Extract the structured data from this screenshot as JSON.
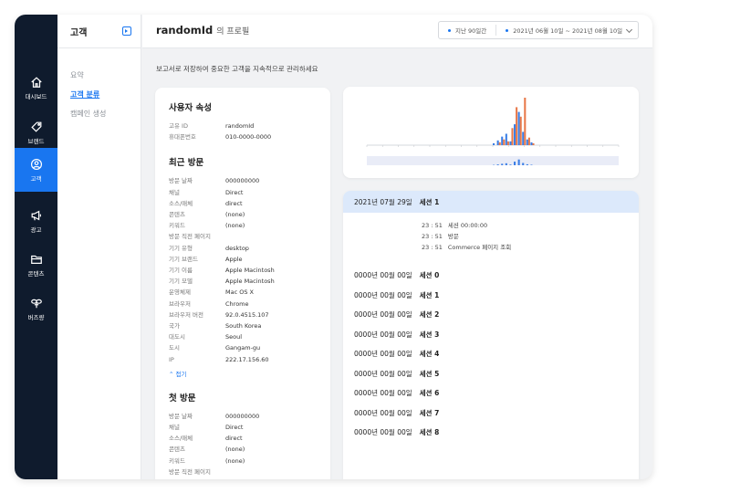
{
  "rail": [
    {
      "label": "대시보드",
      "icon": "home-icon"
    },
    {
      "label": "브랜드",
      "icon": "tag-icon"
    },
    {
      "label": "고객",
      "icon": "user-icon",
      "active": true
    },
    {
      "label": "광고",
      "icon": "megaphone-icon"
    },
    {
      "label": "콘텐츠",
      "icon": "folder-icon"
    },
    {
      "label": "버즈량",
      "icon": "buzz-icon"
    }
  ],
  "subnav": {
    "title": "고객",
    "links": [
      {
        "label": "요약",
        "active": false
      },
      {
        "label": "고객 분류",
        "active": true
      },
      {
        "label": "캠페인 생성",
        "active": false
      }
    ]
  },
  "header": {
    "user": "randomId",
    "suffix": "의 프로필",
    "range_label": "지난 90일간",
    "range_value": "2021년 06월 10일 ~ 2021년 08월 10일"
  },
  "hint": "보고서로 저장하여 중요한 고객을 지속적으로 관리하세요",
  "attributes": {
    "title": "사용자 속성",
    "rows": [
      {
        "k": "고유 ID",
        "v": "randomId"
      },
      {
        "k": "휴대폰번호",
        "v": "010-0000-0000"
      }
    ]
  },
  "recent_visit": {
    "title": "최근 방문",
    "rows": [
      {
        "k": "방문 날짜",
        "v": "000000000"
      },
      {
        "k": "채널",
        "v": "Direct"
      },
      {
        "k": "소스/매체",
        "v": "direct"
      },
      {
        "k": "콘텐츠",
        "v": "(none)"
      },
      {
        "k": "키워드",
        "v": "(none)"
      },
      {
        "k": "방문 직전 페이지",
        "v": ""
      },
      {
        "k": "기기 유형",
        "v": "desktop"
      },
      {
        "k": "기기 브랜드",
        "v": "Apple"
      },
      {
        "k": "기기 이름",
        "v": "Apple Macintosh"
      },
      {
        "k": "기기 모델",
        "v": "Apple Macintosh"
      },
      {
        "k": "운영체제",
        "v": "Mac OS X"
      },
      {
        "k": "브라우저",
        "v": "Chrome"
      },
      {
        "k": "브라우저 버전",
        "v": "92.0.4515.107"
      },
      {
        "k": "국가",
        "v": "South Korea"
      },
      {
        "k": "대도시",
        "v": "Seoul"
      },
      {
        "k": "도시",
        "v": "Gangam-gu"
      },
      {
        "k": "IP",
        "v": "222.17.156.60"
      }
    ],
    "fold_label": "⌃ 접기"
  },
  "first_visit": {
    "title": "첫 방문",
    "rows": [
      {
        "k": "방문 날짜",
        "v": "000000000"
      },
      {
        "k": "채널",
        "v": "Direct"
      },
      {
        "k": "소스/매체",
        "v": "direct"
      },
      {
        "k": "콘텐츠",
        "v": "(none)"
      },
      {
        "k": "키워드",
        "v": "(none)"
      },
      {
        "k": "방문 직전 페이지",
        "v": ""
      }
    ]
  },
  "timeline": {
    "type": "bar",
    "colors": {
      "blue": "#3b7fe6",
      "orange": "#e8794a"
    },
    "blue_values": [
      0,
      0,
      0,
      0,
      0,
      0,
      0,
      0,
      0,
      0,
      0,
      0,
      0,
      0,
      0,
      0,
      0,
      0,
      0,
      0,
      0,
      0,
      0,
      0,
      0,
      0,
      0,
      0,
      0,
      0,
      2,
      5,
      9,
      12,
      4,
      22,
      35,
      14,
      6,
      3,
      0,
      0,
      0,
      0,
      0,
      0,
      0,
      0,
      0,
      0,
      0,
      0,
      0,
      0,
      0,
      0,
      0,
      0,
      0,
      0
    ],
    "orange_values": [
      0,
      0,
      0,
      0,
      0,
      0,
      0,
      0,
      0,
      0,
      0,
      0,
      0,
      0,
      0,
      0,
      0,
      0,
      0,
      0,
      0,
      0,
      0,
      0,
      0,
      0,
      0,
      0,
      0,
      0,
      0,
      3,
      6,
      4,
      18,
      40,
      30,
      50,
      8,
      2,
      0,
      0,
      0,
      0,
      0,
      0,
      0,
      0,
      0,
      0,
      0,
      0,
      0,
      0,
      0,
      0,
      0,
      0,
      0,
      0
    ]
  },
  "sessions": {
    "open": {
      "date": "2021년 07월 29일",
      "name": "세션 1",
      "events": [
        {
          "time": "23 : 51",
          "text": "세션 00:00:00"
        },
        {
          "time": "23 : 51",
          "text": "방문"
        },
        {
          "time": "23 : 51",
          "text": "Commerce 페이지 조회"
        }
      ]
    },
    "list": [
      {
        "date": "0000년 00월 00일",
        "name": "세션 0"
      },
      {
        "date": "0000년 00월 00일",
        "name": "세션 1"
      },
      {
        "date": "0000년 00월 00일",
        "name": "세션 2"
      },
      {
        "date": "0000년 00월 00일",
        "name": "세션 3"
      },
      {
        "date": "0000년 00월 00일",
        "name": "세션 4"
      },
      {
        "date": "0000년 00월 00일",
        "name": "세션 5"
      },
      {
        "date": "0000년 00월 00일",
        "name": "세션 6"
      },
      {
        "date": "0000년 00월 00일",
        "name": "세션 7"
      },
      {
        "date": "0000년 00월 00일",
        "name": "세션 8"
      }
    ]
  }
}
